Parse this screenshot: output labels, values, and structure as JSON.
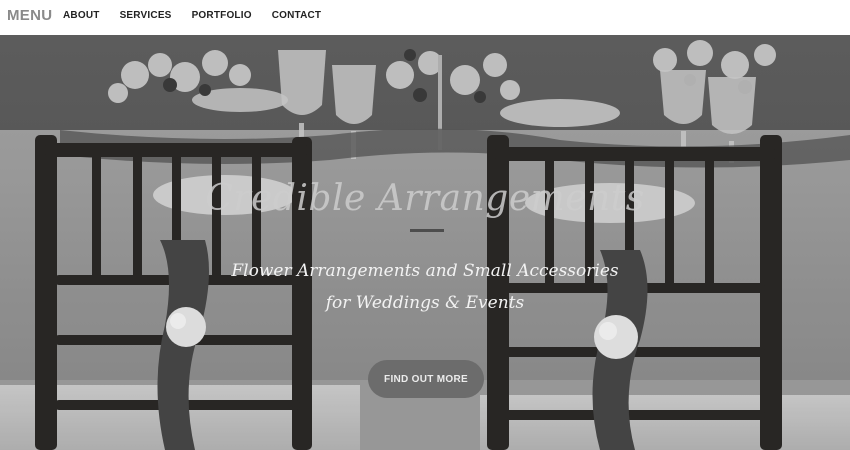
{
  "navbar": {
    "brand": "MENU",
    "links": [
      "ABOUT",
      "SERVICES",
      "PORTFOLIO",
      "CONTACT"
    ]
  },
  "hero": {
    "title": "Credible Arrangements",
    "subtitle_line1": "Flower Arrangements and Small Accessories",
    "subtitle_line2": "for Weddings & Events",
    "cta_label": "FIND OUT MORE"
  },
  "colors": {
    "nav_background": "#ffffff",
    "brand_text": "#8a8a8a",
    "nav_text": "#222222",
    "button_background": "#6c6c6c",
    "button_text": "#ececec"
  }
}
